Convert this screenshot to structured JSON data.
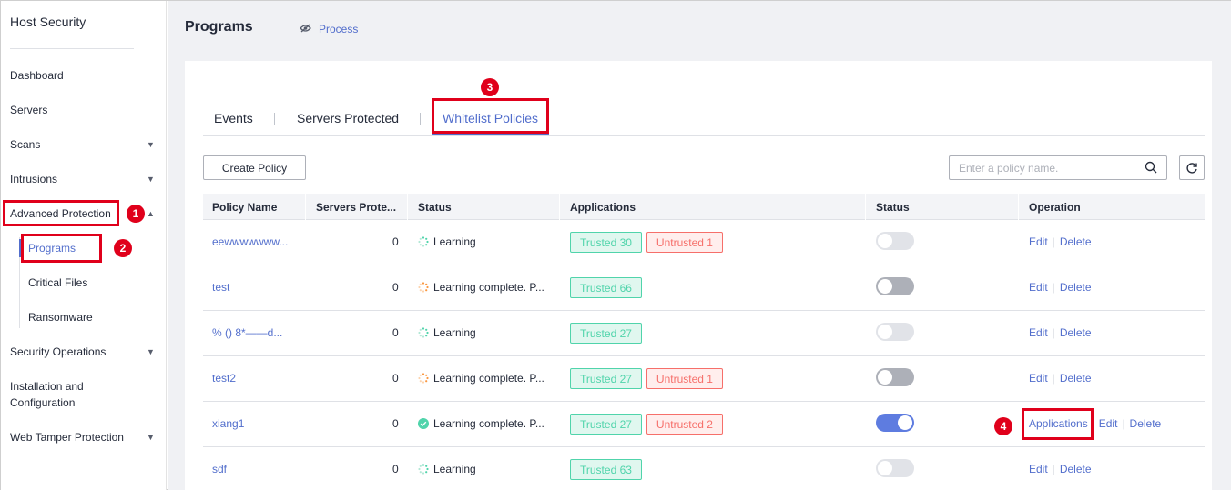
{
  "sidebar": {
    "title": "Host Security",
    "items": [
      {
        "label": "Dashboard"
      },
      {
        "label": "Servers"
      },
      {
        "label": "Scans"
      },
      {
        "label": "Intrusions"
      },
      {
        "label": "Advanced Protection"
      },
      {
        "label": "Programs"
      },
      {
        "label": "Critical Files"
      },
      {
        "label": "Ransomware"
      },
      {
        "label": "Security Operations"
      },
      {
        "label": "Installation and Configuration"
      },
      {
        "label": "Web Tamper Protection"
      }
    ]
  },
  "header": {
    "title": "Programs",
    "process_link": "Process"
  },
  "tabs": [
    {
      "label": "Events"
    },
    {
      "label": "Servers Protected"
    },
    {
      "label": "Whitelist Policies",
      "active": true
    }
  ],
  "toolbar": {
    "create_label": "Create Policy",
    "search_placeholder": "Enter a policy name."
  },
  "table": {
    "columns": [
      "Policy Name",
      "Servers Prote...",
      "Status",
      "Applications",
      "Status",
      "Operation"
    ],
    "rows": [
      {
        "name": "eewwwwwww...",
        "servers": "0",
        "status": "Learning",
        "status_icon": "learning",
        "trusted": "Trusted  30",
        "untrusted": "Untrusted  1",
        "toggle": "disabled",
        "ops": [
          "Edit",
          "Delete"
        ]
      },
      {
        "name": "test",
        "servers": "0",
        "status": "Learning complete. P...",
        "status_icon": "complete-pending",
        "trusted": "Trusted  66",
        "untrusted": "",
        "toggle": "off",
        "ops": [
          "Edit",
          "Delete"
        ]
      },
      {
        "name": "%  ()  8*——d...",
        "servers": "0",
        "status": "Learning",
        "status_icon": "learning",
        "trusted": "Trusted  27",
        "untrusted": "",
        "toggle": "disabled",
        "ops": [
          "Edit",
          "Delete"
        ]
      },
      {
        "name": "test2",
        "servers": "0",
        "status": "Learning complete. P...",
        "status_icon": "complete-pending",
        "trusted": "Trusted  27",
        "untrusted": "Untrusted  1",
        "toggle": "off",
        "ops": [
          "Edit",
          "Delete"
        ]
      },
      {
        "name": "xiang1",
        "servers": "0",
        "status": "Learning complete. P...",
        "status_icon": "complete",
        "trusted": "Trusted  27",
        "untrusted": "Untrusted  2",
        "toggle": "on",
        "ops": [
          "Applications",
          "Edit",
          "Delete"
        ]
      },
      {
        "name": "sdf",
        "servers": "0",
        "status": "Learning",
        "status_icon": "learning",
        "trusted": "Trusted  63",
        "untrusted": "",
        "toggle": "disabled",
        "ops": [
          "Edit",
          "Delete"
        ]
      }
    ]
  },
  "callouts": [
    "1",
    "2",
    "3",
    "4"
  ],
  "colors": {
    "accent": "#526ecc",
    "highlight": "#e0001b",
    "trusted": "#50d4ab",
    "untrusted": "#f66f6a"
  }
}
